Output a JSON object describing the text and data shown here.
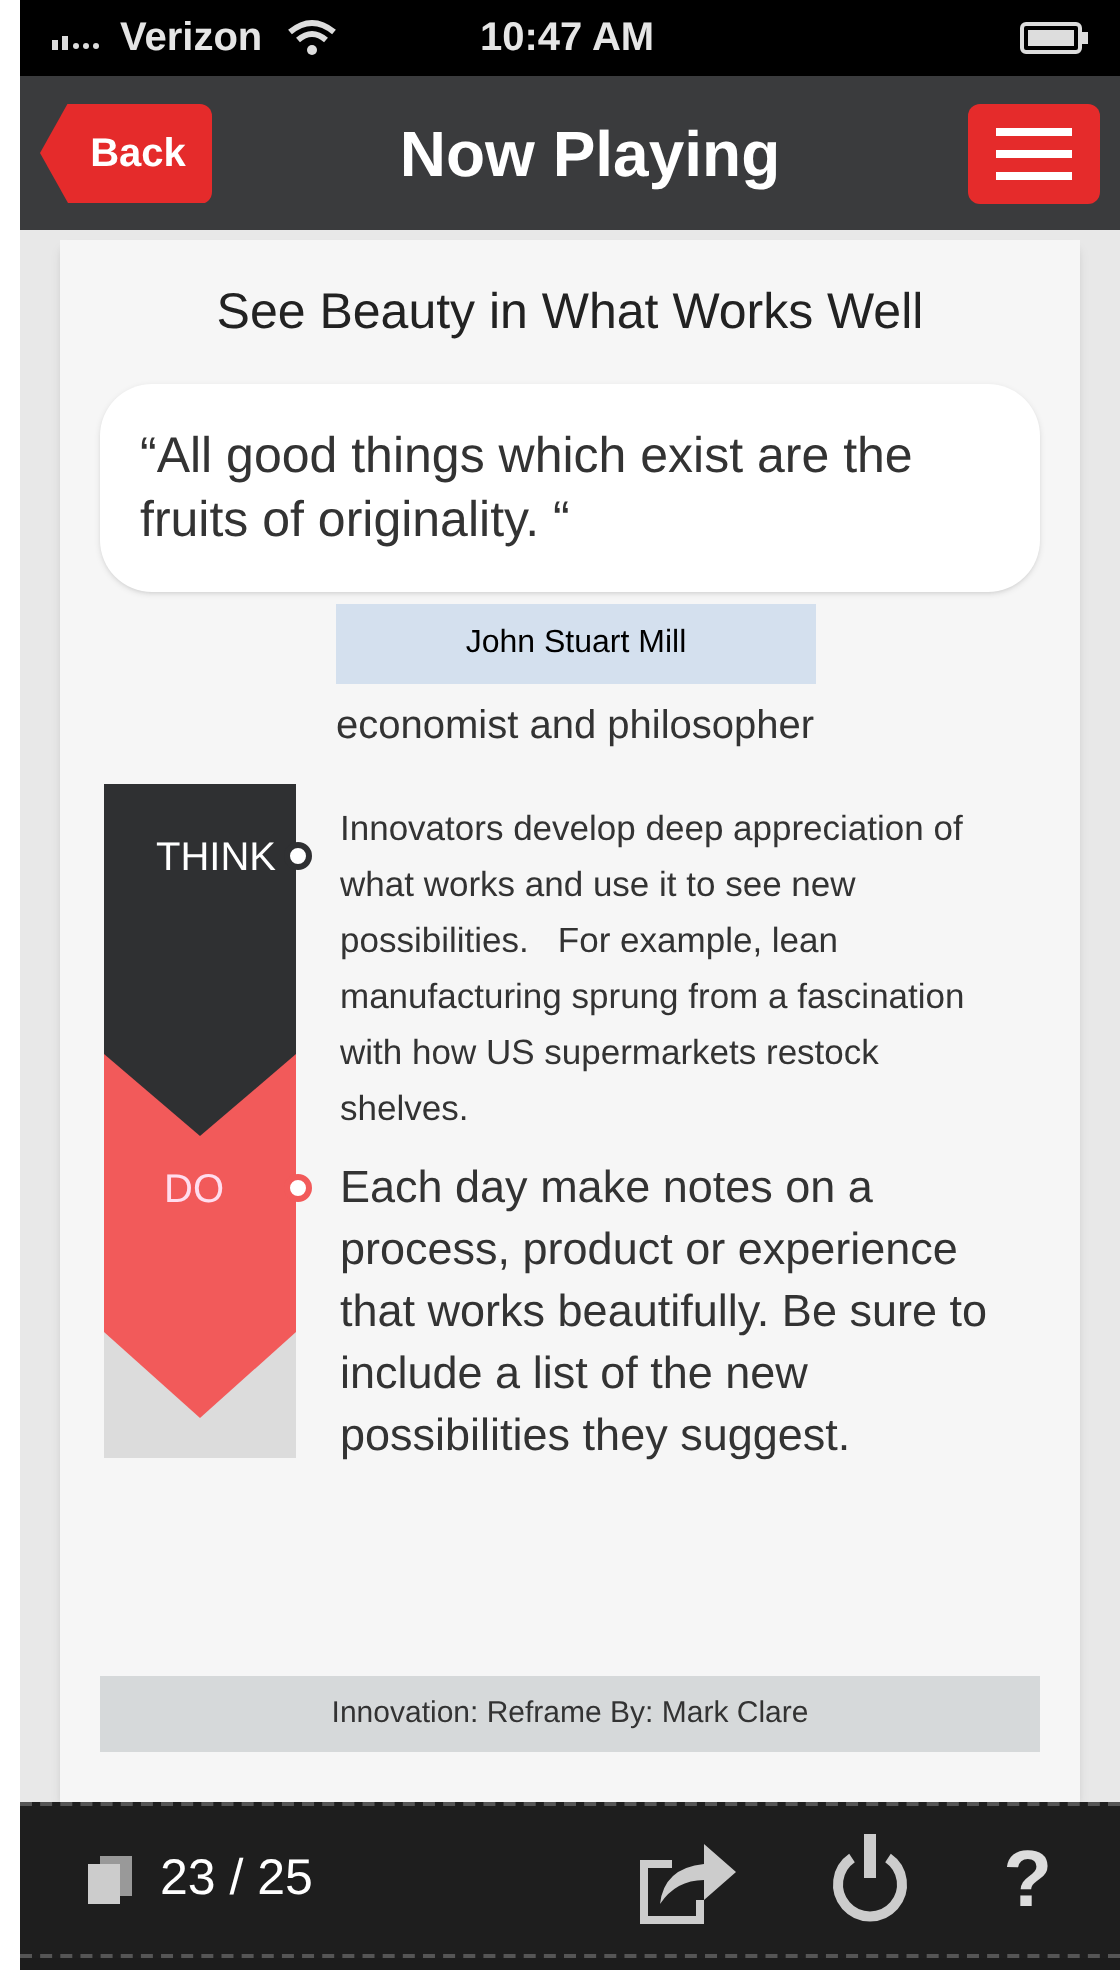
{
  "status_bar": {
    "carrier": "Verizon",
    "time": "10:47 AM"
  },
  "nav": {
    "back": "Back",
    "title": "Now Playing"
  },
  "card": {
    "title": "See Beauty in What Works Well",
    "quote": "“All good things which exist are the fruits of originality. “",
    "author": "John Stuart Mill",
    "author_role": "economist and philosopher",
    "think": {
      "label": "THINK",
      "text": "Innovators develop deep appreciation of what works and use it to see new possibilities.   For example, lean manufacturing sprung from a fascination with how US supermarkets restock shelves."
    },
    "do": {
      "label": "DO",
      "text": "Each day make notes on a process, product or experience that works beautifully. Be sure to include a list of the new possibilities they suggest."
    },
    "footer": "Innovation: Reframe By: Mark Clare"
  },
  "toolbar": {
    "page": "23 / 25",
    "help": "?"
  }
}
